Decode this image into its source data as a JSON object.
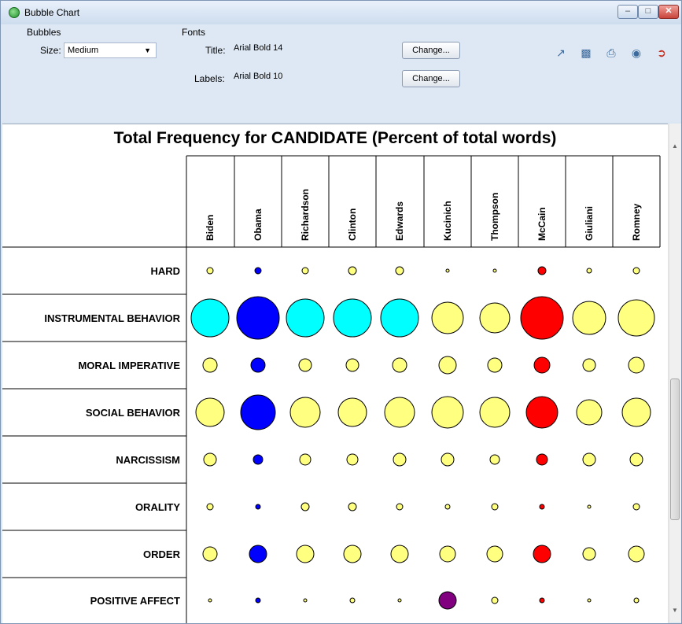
{
  "window": {
    "title": "Bubble Chart"
  },
  "toolbar": {
    "bubbles_group": "Bubbles",
    "size_label": "Size:",
    "size_value": "Medium",
    "fonts_group": "Fonts",
    "title_label": "Title:",
    "title_font": "Arial Bold 14",
    "labels_label": "Labels:",
    "labels_font": "Arial Bold 10",
    "change_label": "Change...",
    "tools": [
      "export-icon",
      "save-icon",
      "print-icon",
      "camera-icon",
      "exit-icon"
    ]
  },
  "chart_data": {
    "type": "bubble",
    "title": "Total Frequency for CANDIDATE (Percent of total words)",
    "columns": [
      "Biden",
      "Obama",
      "Richardson",
      "Clinton",
      "Edwards",
      "Kucinich",
      "Thompson",
      "McCain",
      "Giuliani",
      "Romney"
    ],
    "rows": [
      "HARD",
      "INSTRUMENTAL BEHAVIOR",
      "MORAL IMPERATIVE",
      "SOCIAL BEHAVIOR",
      "NARCISSISM",
      "ORALITY",
      "ORDER",
      "POSITIVE AFFECT"
    ],
    "sizes": [
      [
        4,
        4,
        4,
        5,
        5,
        2,
        2,
        5,
        3,
        4
      ],
      [
        24,
        27,
        24,
        24,
        24,
        20,
        19,
        27,
        21,
        23
      ],
      [
        9,
        9,
        8,
        8,
        9,
        11,
        9,
        10,
        8,
        10
      ],
      [
        18,
        22,
        19,
        18,
        19,
        20,
        19,
        20,
        16,
        18
      ],
      [
        8,
        6,
        7,
        7,
        8,
        8,
        6,
        7,
        8,
        8
      ],
      [
        4,
        3,
        5,
        5,
        4,
        3,
        4,
        3,
        2,
        4
      ],
      [
        9,
        11,
        11,
        11,
        11,
        10,
        10,
        11,
        8,
        10
      ],
      [
        2,
        3,
        2,
        3,
        2,
        11,
        4,
        3,
        2,
        3
      ]
    ],
    "bubble_colors": [
      [
        "#ffff80",
        "#0000ff",
        "#ffff80",
        "#ffff80",
        "#ffff80",
        "#ffff80",
        "#ffff80",
        "#ff0000",
        "#ffff80",
        "#ffff80"
      ],
      [
        "#00ffff",
        "#0000ff",
        "#00ffff",
        "#00ffff",
        "#00ffff",
        "#ffff80",
        "#ffff80",
        "#ff0000",
        "#ffff80",
        "#ffff80"
      ],
      [
        "#ffff80",
        "#0000ff",
        "#ffff80",
        "#ffff80",
        "#ffff80",
        "#ffff80",
        "#ffff80",
        "#ff0000",
        "#ffff80",
        "#ffff80"
      ],
      [
        "#ffff80",
        "#0000ff",
        "#ffff80",
        "#ffff80",
        "#ffff80",
        "#ffff80",
        "#ffff80",
        "#ff0000",
        "#ffff80",
        "#ffff80"
      ],
      [
        "#ffff80",
        "#0000ff",
        "#ffff80",
        "#ffff80",
        "#ffff80",
        "#ffff80",
        "#ffff80",
        "#ff0000",
        "#ffff80",
        "#ffff80"
      ],
      [
        "#ffff80",
        "#0000ff",
        "#ffff80",
        "#ffff80",
        "#ffff80",
        "#ffff80",
        "#ffff80",
        "#ff0000",
        "#ffff80",
        "#ffff80"
      ],
      [
        "#ffff80",
        "#0000ff",
        "#ffff80",
        "#ffff80",
        "#ffff80",
        "#ffff80",
        "#ffff80",
        "#ff0000",
        "#ffff80",
        "#ffff80"
      ],
      [
        "#ffff80",
        "#0000ff",
        "#ffff80",
        "#ffff80",
        "#ffff80",
        "#800080",
        "#ffff80",
        "#ff0000",
        "#ffff80",
        "#ffff80"
      ]
    ]
  }
}
